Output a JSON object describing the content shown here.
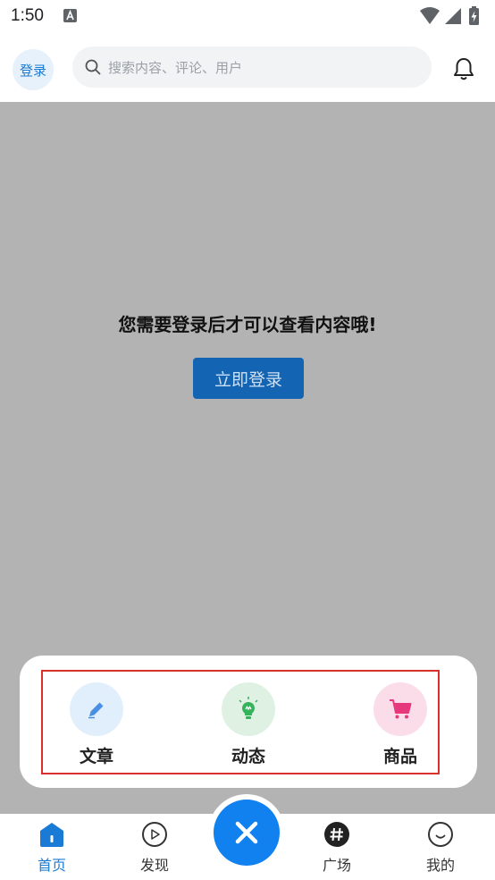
{
  "status_bar": {
    "time": "1:50"
  },
  "header": {
    "login_label": "登录",
    "search_placeholder": "搜索内容、评论、用户"
  },
  "main": {
    "login_message": "您需要登录后才可以查看内容哦!",
    "login_now_label": "立即登录"
  },
  "publish_menu": {
    "items": [
      {
        "label": "文章",
        "icon": "pencil-icon",
        "bg": "#e1eefb",
        "color": "#4a90e2"
      },
      {
        "label": "动态",
        "icon": "lightbulb-icon",
        "bg": "#dff1e3",
        "color": "#35b35b"
      },
      {
        "label": "商品",
        "icon": "cart-icon",
        "bg": "#fbdde9",
        "color": "#e8387d"
      }
    ],
    "highlight_color": "#d9302b"
  },
  "bottom_nav": {
    "items": [
      {
        "label": "首页",
        "icon": "home-icon",
        "active": true
      },
      {
        "label": "发现",
        "icon": "play-circle-icon",
        "active": false
      },
      {
        "label": "广场",
        "icon": "hashtag-icon",
        "active": false
      },
      {
        "label": "我的",
        "icon": "smile-icon",
        "active": false
      }
    ],
    "accent": "#1a7bd6"
  }
}
